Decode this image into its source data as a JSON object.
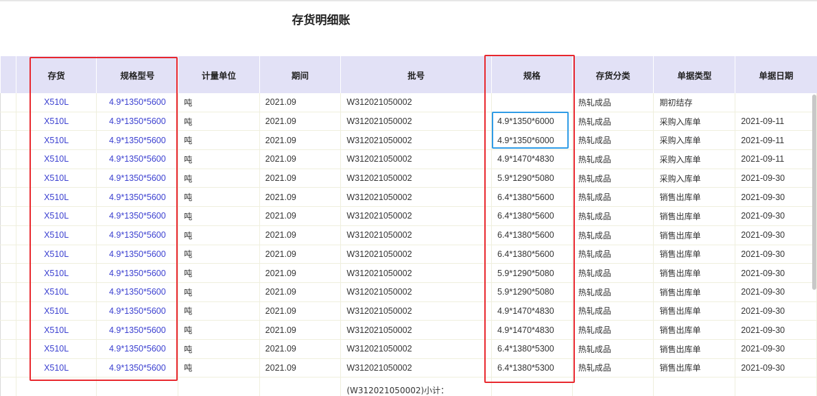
{
  "title": "存货明细账",
  "columns": [
    "存货",
    "规格型号",
    "计量单位",
    "期间",
    "批号",
    "规格",
    "存货分类",
    "单据类型",
    "单据日期"
  ],
  "rows": [
    {
      "item": "X510L",
      "model": "4.9*1350*5600",
      "unit": "吨",
      "period": "2021.09",
      "batch": "W312021050002",
      "spec": "",
      "category": "热轧成品",
      "doctype": "期初结存",
      "date": ""
    },
    {
      "item": "X510L",
      "model": "4.9*1350*5600",
      "unit": "吨",
      "period": "2021.09",
      "batch": "W312021050002",
      "spec": "4.9*1350*6000",
      "category": "热轧成品",
      "doctype": "采购入库单",
      "date": "2021-09-11"
    },
    {
      "item": "X510L",
      "model": "4.9*1350*5600",
      "unit": "吨",
      "period": "2021.09",
      "batch": "W312021050002",
      "spec": "4.9*1350*6000",
      "category": "热轧成品",
      "doctype": "采购入库单",
      "date": "2021-09-11"
    },
    {
      "item": "X510L",
      "model": "4.9*1350*5600",
      "unit": "吨",
      "period": "2021.09",
      "batch": "W312021050002",
      "spec": "4.9*1470*4830",
      "category": "热轧成品",
      "doctype": "采购入库单",
      "date": "2021-09-11"
    },
    {
      "item": "X510L",
      "model": "4.9*1350*5600",
      "unit": "吨",
      "period": "2021.09",
      "batch": "W312021050002",
      "spec": "5.9*1290*5080",
      "category": "热轧成品",
      "doctype": "采购入库单",
      "date": "2021-09-30"
    },
    {
      "item": "X510L",
      "model": "4.9*1350*5600",
      "unit": "吨",
      "period": "2021.09",
      "batch": "W312021050002",
      "spec": "6.4*1380*5600",
      "category": "热轧成品",
      "doctype": "销售出库单",
      "date": "2021-09-30"
    },
    {
      "item": "X510L",
      "model": "4.9*1350*5600",
      "unit": "吨",
      "period": "2021.09",
      "batch": "W312021050002",
      "spec": "6.4*1380*5600",
      "category": "热轧成品",
      "doctype": "销售出库单",
      "date": "2021-09-30"
    },
    {
      "item": "X510L",
      "model": "4.9*1350*5600",
      "unit": "吨",
      "period": "2021.09",
      "batch": "W312021050002",
      "spec": "6.4*1380*5600",
      "category": "热轧成品",
      "doctype": "销售出库单",
      "date": "2021-09-30"
    },
    {
      "item": "X510L",
      "model": "4.9*1350*5600",
      "unit": "吨",
      "period": "2021.09",
      "batch": "W312021050002",
      "spec": "6.4*1380*5600",
      "category": "热轧成品",
      "doctype": "销售出库单",
      "date": "2021-09-30"
    },
    {
      "item": "X510L",
      "model": "4.9*1350*5600",
      "unit": "吨",
      "period": "2021.09",
      "batch": "W312021050002",
      "spec": "5.9*1290*5080",
      "category": "热轧成品",
      "doctype": "销售出库单",
      "date": "2021-09-30"
    },
    {
      "item": "X510L",
      "model": "4.9*1350*5600",
      "unit": "吨",
      "period": "2021.09",
      "batch": "W312021050002",
      "spec": "5.9*1290*5080",
      "category": "热轧成品",
      "doctype": "销售出库单",
      "date": "2021-09-30"
    },
    {
      "item": "X510L",
      "model": "4.9*1350*5600",
      "unit": "吨",
      "period": "2021.09",
      "batch": "W312021050002",
      "spec": "4.9*1470*4830",
      "category": "热轧成品",
      "doctype": "销售出库单",
      "date": "2021-09-30"
    },
    {
      "item": "X510L",
      "model": "4.9*1350*5600",
      "unit": "吨",
      "period": "2021.09",
      "batch": "W312021050002",
      "spec": "4.9*1470*4830",
      "category": "热轧成品",
      "doctype": "销售出库单",
      "date": "2021-09-30"
    },
    {
      "item": "X510L",
      "model": "4.9*1350*5600",
      "unit": "吨",
      "period": "2021.09",
      "batch": "W312021050002",
      "spec": "6.4*1380*5300",
      "category": "热轧成品",
      "doctype": "销售出库单",
      "date": "2021-09-30"
    },
    {
      "item": "X510L",
      "model": "4.9*1350*5600",
      "unit": "吨",
      "period": "2021.09",
      "batch": "W312021050002",
      "spec": "6.4*1380*5300",
      "category": "热轧成品",
      "doctype": "销售出库单",
      "date": "2021-09-30"
    }
  ],
  "subtotal_label": "(W312021050002)小计："
}
